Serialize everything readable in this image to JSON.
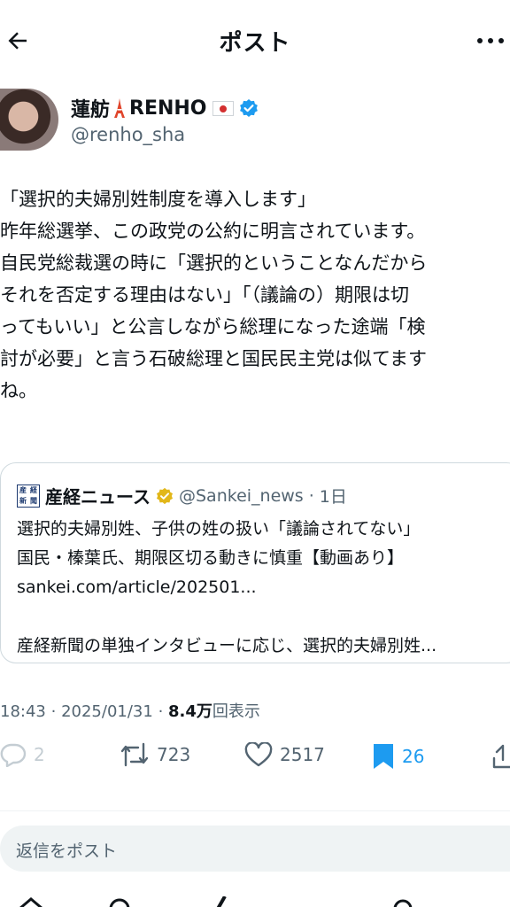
{
  "header": {
    "title": "ポスト",
    "back_icon": "arrow-left-icon",
    "more_icon": "more-horizontal-icon"
  },
  "author": {
    "name": "蓮舫",
    "name_suffix": "RENHO",
    "handle": "@renho_sha",
    "verified": true,
    "colors": {
      "verified": "#1d9bf0"
    }
  },
  "post": {
    "lines": [
      "「選択的夫婦別姓制度を導入します」",
      "昨年総選挙、この政党の公約に明言されています。",
      "自民党総裁選の時に「選択的ということなんだから",
      "それを否定する理由はない」「（議論の）期限は切",
      "ってもいい」と公言しながら総理になった途端「検",
      "討が必要」と言う石破総理と国民民主党は似てます",
      "ね。"
    ]
  },
  "quote": {
    "logo_chars": [
      "産",
      "経",
      "新",
      "聞"
    ],
    "name": "産経ニュース",
    "handle": "@Sankei_news",
    "separator": "·",
    "time": "1日",
    "lines": [
      "選択的夫婦別姓、子供の姓の扱い「議論されてない」",
      "国民・榛葉氏、期限区切る動きに慎重【動画あり】",
      "sankei.com/article/202501..."
    ],
    "snippet": "産経新聞の単独インタビューに応じ、選択的夫婦別姓...",
    "colors": {
      "gold_verified": "#e2b719"
    }
  },
  "meta": {
    "time": "18:43",
    "separator": "·",
    "date": "2025/01/31",
    "views_count": "8.4万",
    "views_label": "回表示"
  },
  "actions": {
    "replies": "2",
    "reposts": "723",
    "likes": "2517",
    "bookmarks": "26",
    "colors": {
      "bookmark_active": "#1d9bf0"
    }
  },
  "reply": {
    "placeholder": "返信をポスト"
  }
}
